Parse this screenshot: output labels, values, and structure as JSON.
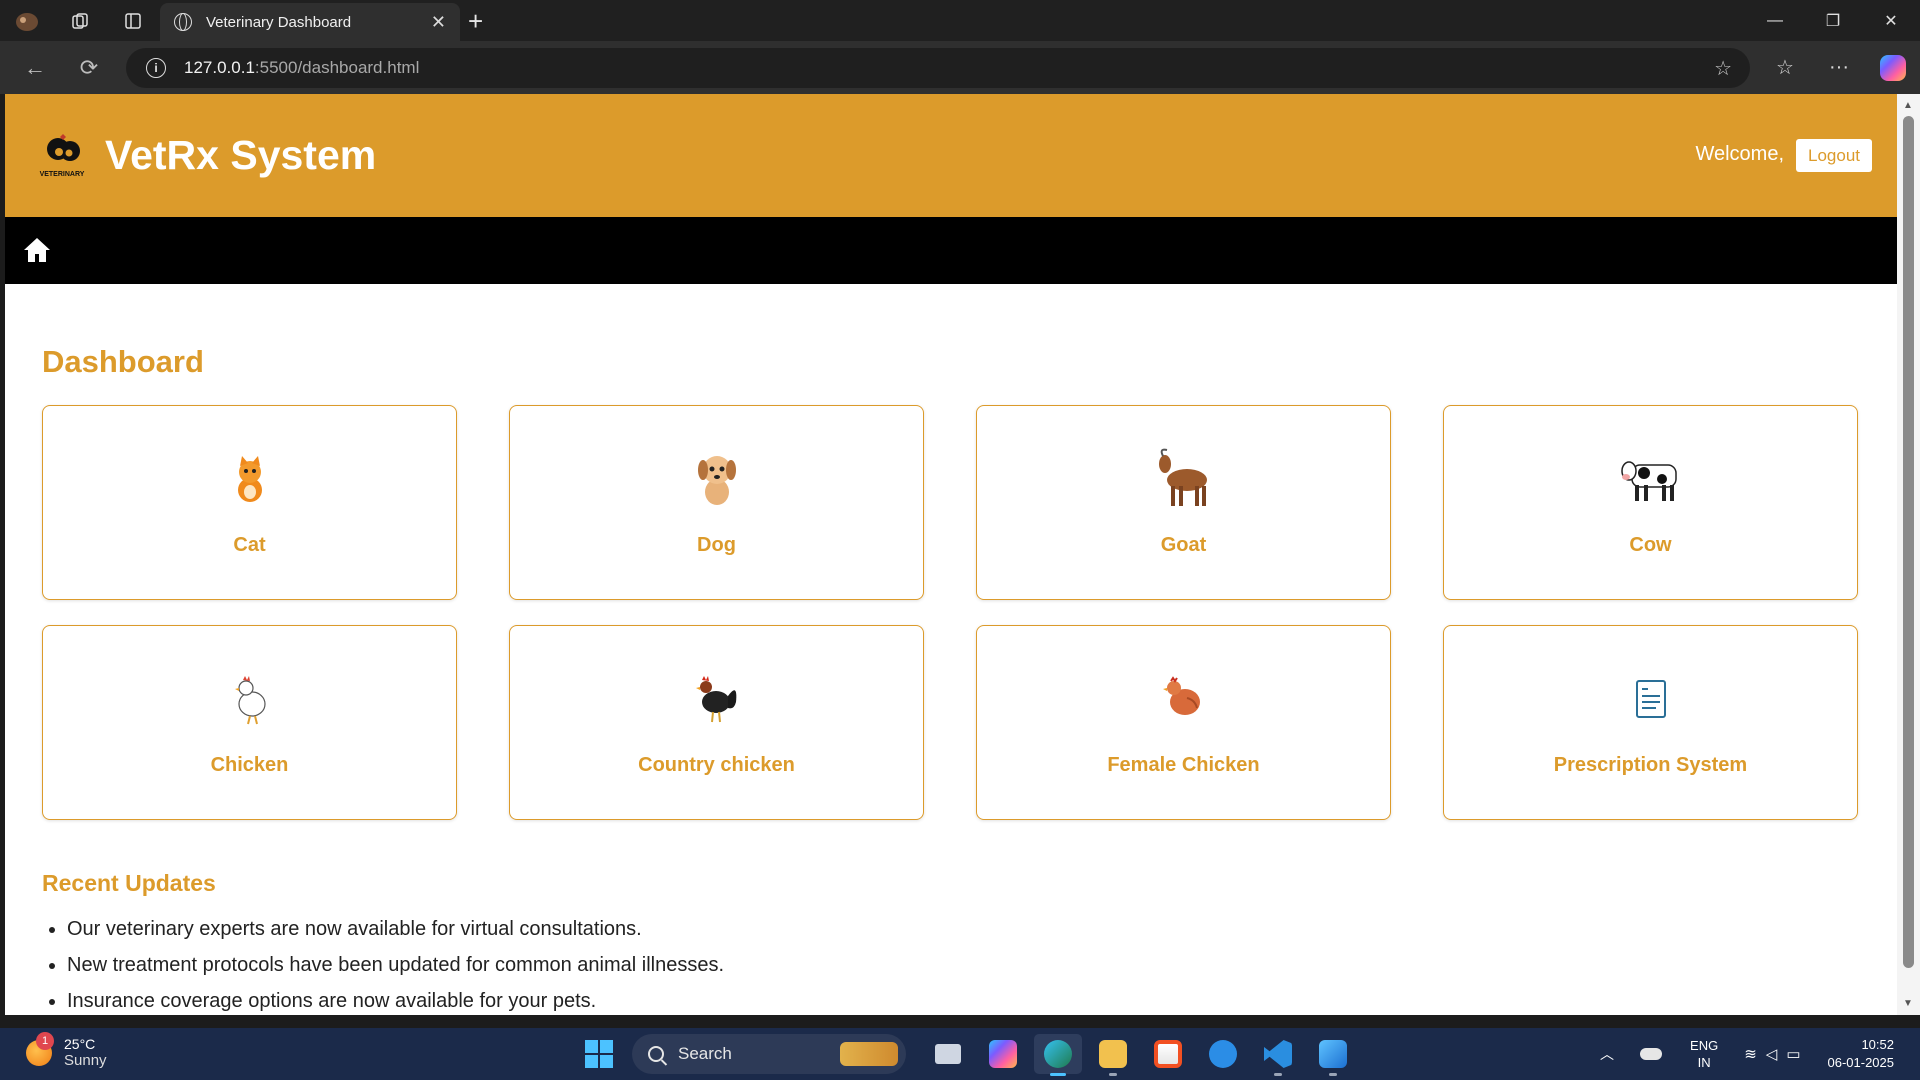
{
  "browser": {
    "tab_title": "Veterinary Dashboard",
    "url_host": "127.0.0.1",
    "url_path": ":5500/dashboard.html"
  },
  "header": {
    "brand": "VetRx System",
    "logo_text": "VETERINARY",
    "welcome": "Welcome,",
    "logout": "Logout"
  },
  "nav": {
    "home_icon": "home-icon"
  },
  "dashboard": {
    "title": "Dashboard",
    "cards": [
      {
        "label": "Cat",
        "icon": "cat-icon"
      },
      {
        "label": "Dog",
        "icon": "dog-icon"
      },
      {
        "label": "Goat",
        "icon": "goat-icon"
      },
      {
        "label": "Cow",
        "icon": "cow-icon"
      },
      {
        "label": "Chicken",
        "icon": "chicken-icon"
      },
      {
        "label": "Country chicken",
        "icon": "rooster-icon"
      },
      {
        "label": "Female Chicken",
        "icon": "hen-icon"
      },
      {
        "label": "Prescription System",
        "icon": "prescription-icon"
      }
    ]
  },
  "updates": {
    "title": "Recent Updates",
    "items": [
      "Our veterinary experts are now available for virtual consultations.",
      "New treatment protocols have been updated for common animal illnesses.",
      "Insurance coverage options are now available for your pets."
    ]
  },
  "taskbar": {
    "weather_temp": "25°C",
    "weather_desc": "Sunny",
    "weather_badge": "1",
    "search": "Search",
    "lang_1": "ENG",
    "lang_2": "IN",
    "time": "10:52",
    "date": "06-01-2025"
  },
  "colors": {
    "accent": "#dc9b2b",
    "navbar": "#000000",
    "taskbar": "#1b2a4a"
  }
}
